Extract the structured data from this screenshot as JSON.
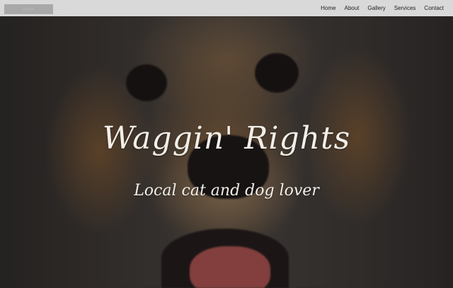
{
  "header": {
    "logo_text": "LOGO",
    "nav": [
      "Home",
      "About",
      "Gallery",
      "Services",
      "Contact"
    ]
  },
  "hero": {
    "title": "Waggin' Rights",
    "subtitle": "Local cat and dog lover"
  },
  "colors": {
    "topbar_bg": "#d9d9d9",
    "text_light": "#f2efe9",
    "tongue": "#c25a56"
  }
}
